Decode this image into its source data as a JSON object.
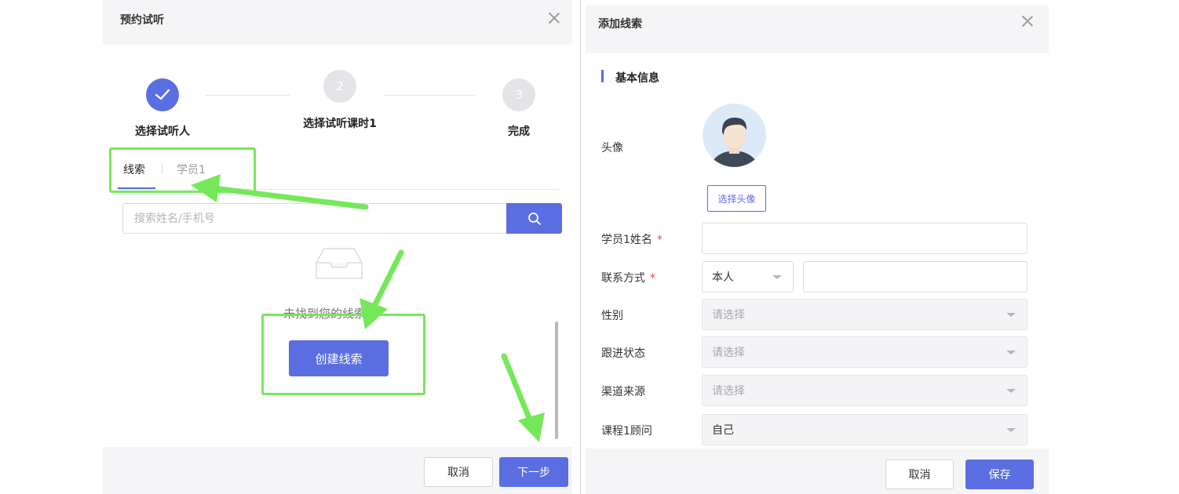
{
  "left_dialog": {
    "title": "预约试听",
    "steps": [
      {
        "number": "1",
        "label": "选择试听人",
        "state": "done"
      },
      {
        "number": "2",
        "label": "选择试听课时1",
        "state": "todo"
      },
      {
        "number": "3",
        "label": "完成",
        "state": "todo"
      }
    ],
    "tabs": [
      {
        "label": "线索",
        "active": true
      },
      {
        "label": "学员1",
        "active": false
      }
    ],
    "search": {
      "placeholder": "搜索姓名/手机号",
      "value": ""
    },
    "empty_text": "未找到您的线索",
    "create_button": "创建线索",
    "footer": {
      "cancel": "取消",
      "next": "下一步"
    }
  },
  "right_dialog": {
    "title": "添加线索",
    "section_title": "基本信息",
    "avatar": {
      "label": "头像",
      "button": "选择头像"
    },
    "fields": {
      "student_name": {
        "label": "学员1姓名",
        "required": "*",
        "value": ""
      },
      "contact": {
        "label": "联系方式",
        "required": "*",
        "relation": "本人",
        "value": ""
      },
      "gender": {
        "label": "性别",
        "placeholder": "请选择"
      },
      "follow_status": {
        "label": "跟进状态",
        "placeholder": "请选择"
      },
      "channel_source": {
        "label": "渠道来源",
        "placeholder": "请选择"
      },
      "course_advisor": {
        "label": "课程1顾问",
        "value": "自己"
      }
    },
    "footer": {
      "cancel": "取消",
      "save": "保存"
    }
  },
  "colors": {
    "accent": "#5b6ee1",
    "annotation_green": "#75e85a",
    "required_red": "#e5484d",
    "header_bg": "#f5f5f7"
  },
  "icons": [
    "check-icon",
    "close-icon",
    "search-icon",
    "empty-inbox-icon",
    "avatar-icon",
    "chevron-down-icon",
    "annotation-arrow"
  ]
}
